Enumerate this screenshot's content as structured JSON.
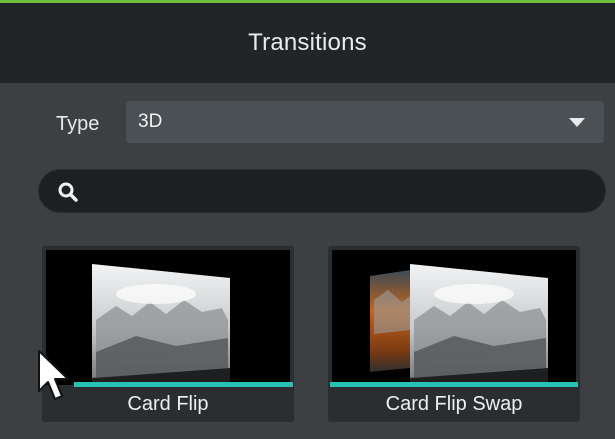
{
  "header": {
    "title": "Transitions"
  },
  "filter": {
    "type_label": "Type",
    "type_value": "3D"
  },
  "search": {
    "placeholder": "",
    "value": ""
  },
  "transitions": [
    {
      "label": "Card Flip"
    },
    {
      "label": "Card Flip Swap"
    }
  ],
  "colors": {
    "accent_strip": "#6bbf3a",
    "selection_bar": "#27c2b1",
    "panel_bg": "#3c4043",
    "header_bg": "#222528"
  },
  "icons": {
    "search": "search-icon",
    "dropdown": "chevron-down-icon",
    "pointer": "mouse-pointer-icon"
  }
}
